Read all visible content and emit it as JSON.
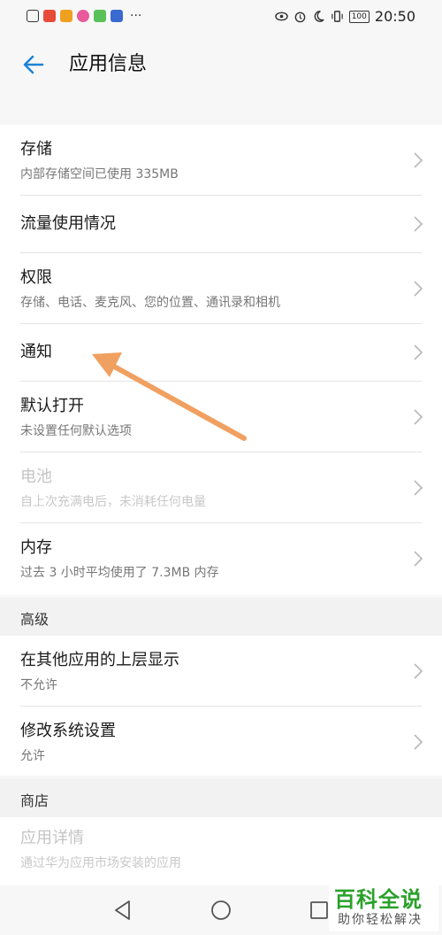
{
  "status_bar": {
    "time": "20:50",
    "battery": "100",
    "icons": [
      "alert-icon",
      "app-icon",
      "app-icon",
      "app-icon",
      "app-icon",
      "app-icon",
      "more-icon"
    ],
    "right_icons": [
      "eye-icon",
      "alarm-icon",
      "moon-icon",
      "vibrate-icon"
    ],
    "overflow": "···"
  },
  "header": {
    "title": "应用信息",
    "back_icon": "arrow-left-icon"
  },
  "items": [
    {
      "title": "存储",
      "sub": "内部存储空间已使用 335MB"
    },
    {
      "title": "流量使用情况",
      "sub": ""
    },
    {
      "title": "权限",
      "sub": "存储、电话、麦克风、您的位置、通讯录和相机"
    },
    {
      "title": "通知",
      "sub": ""
    },
    {
      "title": "默认打开",
      "sub": "未设置任何默认选项"
    },
    {
      "title": "电池",
      "sub": "自上次充满电后，未消耗任何电量"
    },
    {
      "title": "内存",
      "sub": "过去 3 小时平均使用了 7.3MB 内存"
    }
  ],
  "advanced": {
    "header": "高级",
    "items": [
      {
        "title": "在其他应用的上层显示",
        "sub": "不允许"
      },
      {
        "title": "修改系统设置",
        "sub": "允许"
      }
    ]
  },
  "store": {
    "header": "商店",
    "items": [
      {
        "title": "应用详情",
        "sub": "通过华为应用市场安装的应用"
      }
    ]
  },
  "watermark": {
    "main": "百科全说",
    "sub": "助你轻松解决"
  },
  "colors": {
    "accent": "#1e82d6",
    "annotation_arrow": "#f0a060",
    "watermark": "#2aa12a"
  }
}
